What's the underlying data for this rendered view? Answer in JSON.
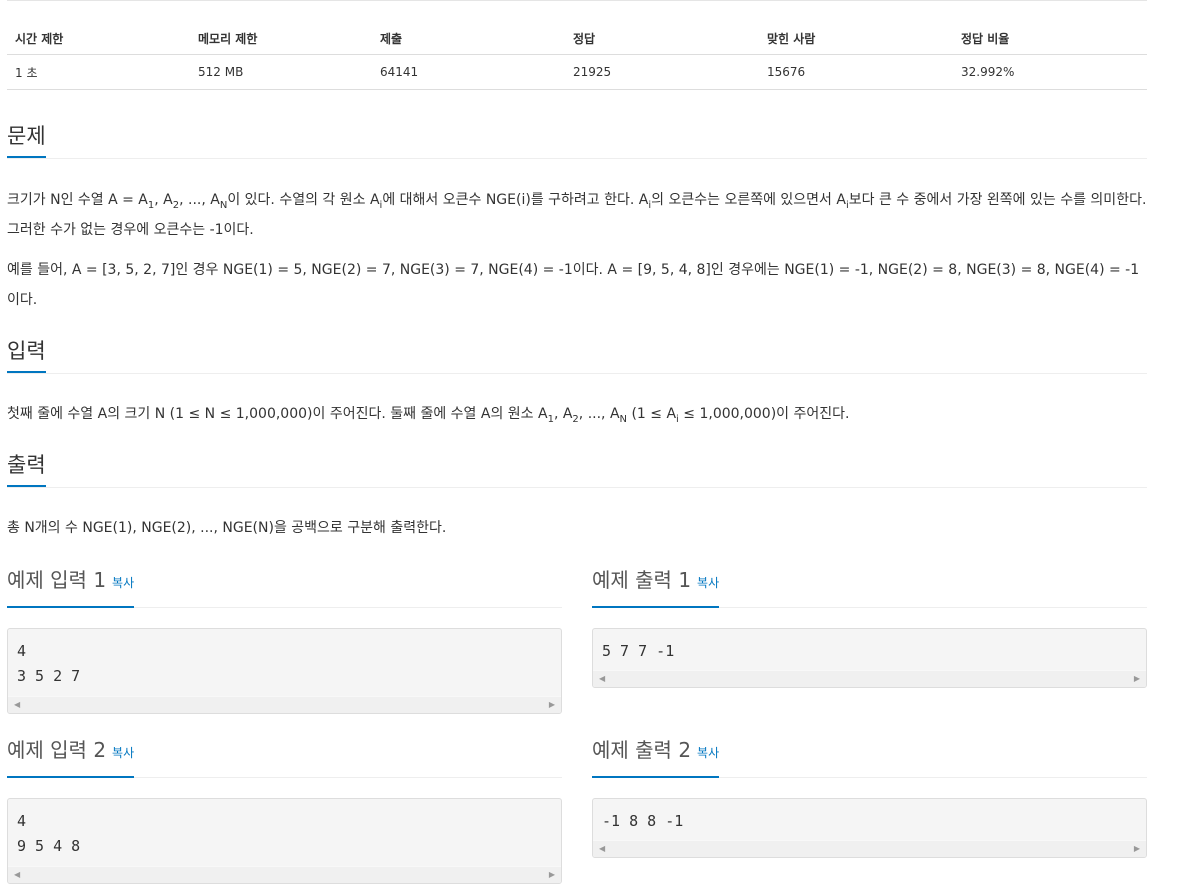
{
  "info": {
    "headers": [
      "시간 제한",
      "메모리 제한",
      "제출",
      "정답",
      "맞힌 사람",
      "정답 비율"
    ],
    "values": [
      "1 초",
      "512 MB",
      "64141",
      "21925",
      "15676",
      "32.992%"
    ]
  },
  "problem": {
    "title": "문제",
    "p1a": "크기가 N인 수열 A = A",
    "p1b": ", A",
    "p1c": ", ..., A",
    "p1d": "이 있다. 수열의 각 원소 A",
    "p1e": "에 대해서 오큰수 NGE(i)를 구하려고 한다. A",
    "p1f": "의 오큰수는 오른쪽에 있으면서 A",
    "p1g": "보다 큰 수 중에서 가장 왼쪽에 있는 수를 의미한다. 그러한 수가 없는 경우에 오큰수는 -1이다.",
    "sub1": "1",
    "sub2": "2",
    "subN": "N",
    "subi": "i",
    "p2": "예를 들어, A = [3, 5, 2, 7]인 경우 NGE(1) = 5, NGE(2) = 7, NGE(3) = 7, NGE(4) = -1이다. A = [9, 5, 4, 8]인 경우에는 NGE(1) = -1, NGE(2) = 8, NGE(3) = 8, NGE(4) = -1이다."
  },
  "input": {
    "title": "입력",
    "a": "첫째 줄에 수열 A의 크기 N (1 ≤ N ≤ 1,000,000)이 주어진다. 둘째 줄에 수열 A의 원소 A",
    "b": ", A",
    "c": ", ..., A",
    "d": " (1 ≤ A",
    "e": " ≤ 1,000,000)이 주어진다."
  },
  "output": {
    "title": "출력",
    "text": "총 N개의 수 NGE(1), NGE(2), ..., NGE(N)을 공백으로 구분해 출력한다."
  },
  "examples": {
    "copy_label": "복사",
    "in1_title": "예제 입력 1",
    "in1_body": "4\n3 5 2 7",
    "out1_title": "예제 출력 1",
    "out1_body": "5 7 7 -1",
    "in2_title": "예제 입력 2",
    "in2_body": "4\n9 5 4 8",
    "out2_title": "예제 출력 2",
    "out2_body": "-1 8 8 -1"
  },
  "colors": {
    "accent": "#0076c0"
  }
}
